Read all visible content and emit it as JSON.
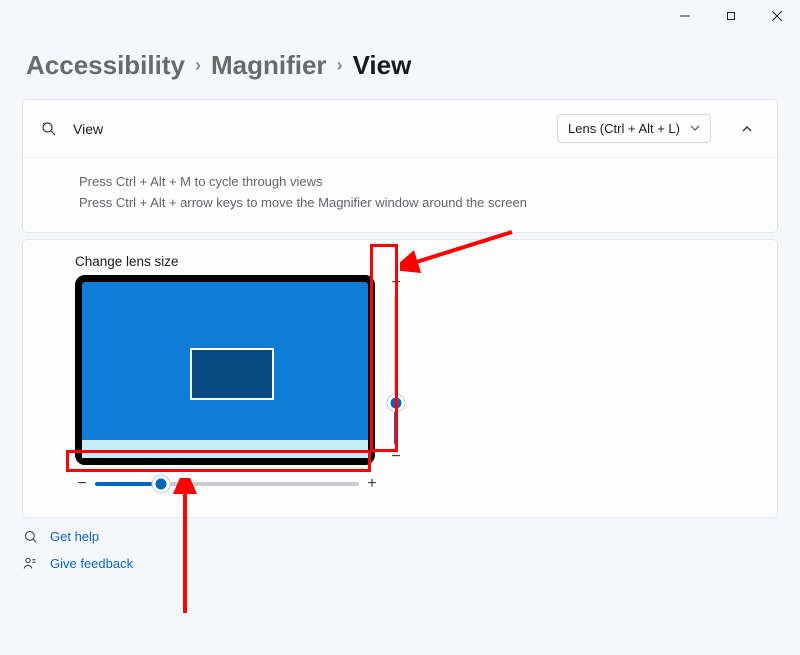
{
  "breadcrumb": {
    "crumb1": "Accessibility",
    "crumb2": "Magnifier",
    "crumb3": "View"
  },
  "view_card": {
    "title": "View",
    "dropdown_label": "Lens (Ctrl + Alt + L)",
    "tip1": "Press Ctrl + Alt + M to cycle through views",
    "tip2": "Press Ctrl + Alt + arrow keys to move the Magnifier window around the screen"
  },
  "lens": {
    "title": "Change lens size"
  },
  "links": {
    "help": "Get help",
    "feedback": "Give feedback"
  },
  "icons": {
    "view": "view-icon",
    "help": "help-icon",
    "feedback": "feedback-icon"
  }
}
